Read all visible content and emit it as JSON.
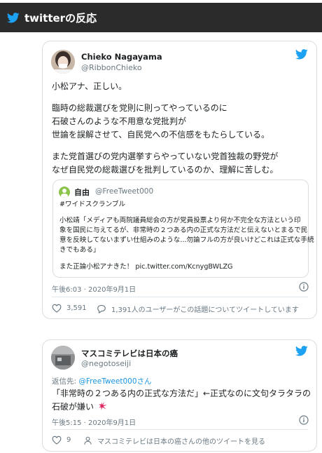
{
  "header": {
    "title": "twitterの反応",
    "bird_color": "#1da1f2"
  },
  "tweet1": {
    "name": "Chieko Nagayama",
    "handle": "@RibbonChieko",
    "text_lines": [
      "小松アナ、正しい。",
      "臨時の総裁選びを党則に則ってやっているのに",
      "石破さんのような不用意な党批判が",
      "世論を誤解させて、自民党への不信感をもたらしている。",
      "また党首選びの党内選挙すらやっていない党首独裁の野党が",
      "なぜ自民党の総裁選びを批判しているのか、理解に苦しむ。"
    ],
    "quote": {
      "name": "自由",
      "handle": "@FreeTweet000",
      "lines": [
        "#ワイドスクランブル",
        "小松靖「メディアも両院議員総会の方が党員投票より何か不完全な方法という印",
        "象を国民に与えてるが、非常時の２つある内の正式な方法だと伝えないとまるで民",
        "意を反映してないまずい仕組みのような...勿論フルの方が良いけどこれは正式な手続",
        "きでもある」",
        "また正論小松アナきた！ pic.twitter.com/KcnygBWLZG"
      ]
    },
    "timestamp": "午後6:03 · 2020年9月1日",
    "likes": "3,591",
    "replies_text": "1,391人のユーザーがこの話題についてツイートしています"
  },
  "tweet2": {
    "name": "マスコミテレビは日本の癌",
    "handle": "@negotoseiji",
    "reply_to_prefix": "返信先:",
    "reply_to_handle": "@FreeTweet000さん",
    "text_lines": [
      "「非常時の２つある内の正式な方法だ」←正式なのに文句タラタラの",
      "石破が嫌い"
    ],
    "emoji": "anger-symbol",
    "timestamp": "午後5:15 · 2020年9月1日",
    "likes": "9",
    "more_text": "マスコミテレビは日本の癌さんの他のツイートを見る"
  },
  "colors": {
    "link": "#1b95e0",
    "like": "#697882",
    "anger": "#e0245e"
  }
}
